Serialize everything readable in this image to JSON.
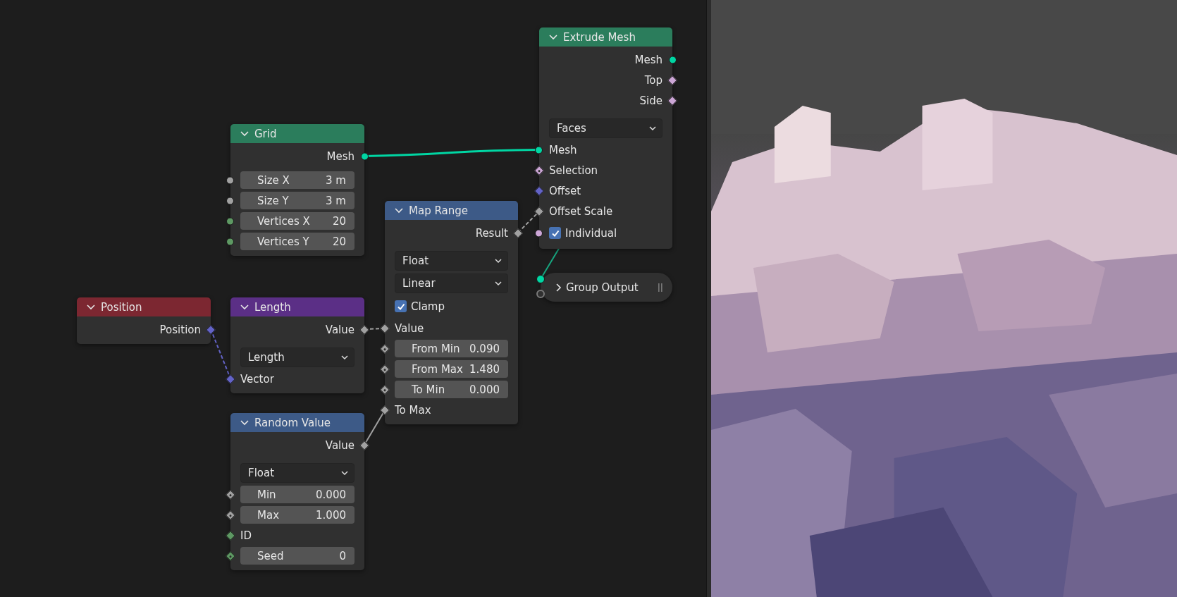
{
  "nodes": [
    {
      "title": "Grid",
      "color": "#2b7d5c",
      "expanded": true,
      "rows": [
        {
          "kind": "output",
          "label": "Mesh",
          "socket": {
            "kind": "circle",
            "color": "#00d6a3"
          }
        },
        {
          "kind": "field",
          "label": "Size X",
          "value": "3 m",
          "socket": {
            "kind": "circle",
            "color": "#a1a1a1"
          }
        },
        {
          "kind": "field",
          "label": "Size Y",
          "value": "3 m",
          "socket": {
            "kind": "circle",
            "color": "#a1a1a1"
          }
        },
        {
          "kind": "field",
          "label": "Vertices X",
          "value": "20",
          "socket": {
            "kind": "circle",
            "color": "#5e9963"
          }
        },
        {
          "kind": "field",
          "label": "Vertices Y",
          "value": "20",
          "socket": {
            "kind": "circle",
            "color": "#5e9963"
          }
        }
      ]
    },
    {
      "title": "Position",
      "color": "#7c2731",
      "expanded": true,
      "rows": [
        {
          "kind": "output",
          "label": "Position",
          "socket": {
            "kind": "diamond",
            "color": "#6363c7"
          }
        }
      ]
    },
    {
      "title": "Length",
      "color": "#5b2f86",
      "expanded": true,
      "rows": [
        {
          "kind": "output",
          "label": "Value",
          "socket": {
            "kind": "diamond",
            "color": "#a1a1a1"
          }
        },
        {
          "kind": "dropdown",
          "label": "Length"
        },
        {
          "kind": "input",
          "label": "Vector",
          "socket": {
            "kind": "diamond",
            "color": "#6363c7"
          }
        }
      ]
    },
    {
      "title": "Random Value",
      "color": "#3d5a87",
      "expanded": true,
      "rows": [
        {
          "kind": "output",
          "label": "Value",
          "socket": {
            "kind": "diamond",
            "color": "#a1a1a1"
          }
        },
        {
          "kind": "dropdown",
          "label": "Float"
        },
        {
          "kind": "field",
          "label": "Min",
          "value": "0.000",
          "socket": {
            "kind": "dotted",
            "color": "#a1a1a1"
          }
        },
        {
          "kind": "field",
          "label": "Max",
          "value": "1.000",
          "socket": {
            "kind": "dotted",
            "color": "#a1a1a1"
          }
        },
        {
          "kind": "input",
          "label": "ID",
          "socket": {
            "kind": "diamond",
            "color": "#5e9963"
          }
        },
        {
          "kind": "field",
          "label": "Seed",
          "value": "0",
          "socket": {
            "kind": "dotted",
            "color": "#5e9963"
          }
        }
      ]
    },
    {
      "title": "Map Range",
      "color": "#3d5a87",
      "expanded": true,
      "rows": [
        {
          "kind": "output",
          "label": "Result",
          "socket": {
            "kind": "diamond",
            "color": "#a1a1a1"
          }
        },
        {
          "kind": "dropdown",
          "label": "Float"
        },
        {
          "kind": "dropdown",
          "label": "Linear"
        },
        {
          "kind": "checkbox",
          "label": "Clamp",
          "checked": true
        },
        {
          "kind": "input",
          "label": "Value",
          "socket": {
            "kind": "diamond",
            "color": "#a1a1a1"
          }
        },
        {
          "kind": "field",
          "label": "From Min",
          "value": "0.090",
          "socket": {
            "kind": "dotted",
            "color": "#a1a1a1"
          }
        },
        {
          "kind": "field",
          "label": "From Max",
          "value": "1.480",
          "socket": {
            "kind": "dotted",
            "color": "#a1a1a1"
          }
        },
        {
          "kind": "field",
          "label": "To Min",
          "value": "0.000",
          "socket": {
            "kind": "dotted",
            "color": "#a1a1a1"
          }
        },
        {
          "kind": "input",
          "label": "To Max",
          "socket": {
            "kind": "diamond",
            "color": "#a1a1a1"
          }
        }
      ]
    },
    {
      "title": "Extrude Mesh",
      "color": "#2b7d5c",
      "expanded": true,
      "rows": [
        {
          "kind": "output",
          "label": "Mesh",
          "socket": {
            "kind": "circle",
            "color": "#00d6a3"
          }
        },
        {
          "kind": "output",
          "label": "Top",
          "socket": {
            "kind": "diamond",
            "color": "#cca6d6"
          }
        },
        {
          "kind": "output",
          "label": "Side",
          "socket": {
            "kind": "diamond",
            "color": "#cca6d6"
          }
        },
        {
          "kind": "dropdown",
          "label": "Faces"
        },
        {
          "kind": "input",
          "label": "Mesh",
          "socket": {
            "kind": "circle",
            "color": "#00d6a3"
          }
        },
        {
          "kind": "input",
          "label": "Selection",
          "socket": {
            "kind": "dotted",
            "color": "#cca6d6"
          }
        },
        {
          "kind": "input",
          "label": "Offset",
          "socket": {
            "kind": "diamond",
            "color": "#6363c7"
          }
        },
        {
          "kind": "input",
          "label": "Offset Scale",
          "socket": {
            "kind": "diamond",
            "color": "#a1a1a1"
          }
        },
        {
          "kind": "checkbox",
          "label": "Individual",
          "checked": true,
          "socket": {
            "kind": "circle",
            "color": "#cca6d6"
          }
        }
      ]
    },
    {
      "title": "Group Output",
      "expanded": false,
      "sockets": [
        {
          "kind": "circle",
          "color": "#00d6a3"
        },
        {
          "kind": "hollow",
          "color": "#7a7a7a"
        }
      ]
    }
  ]
}
